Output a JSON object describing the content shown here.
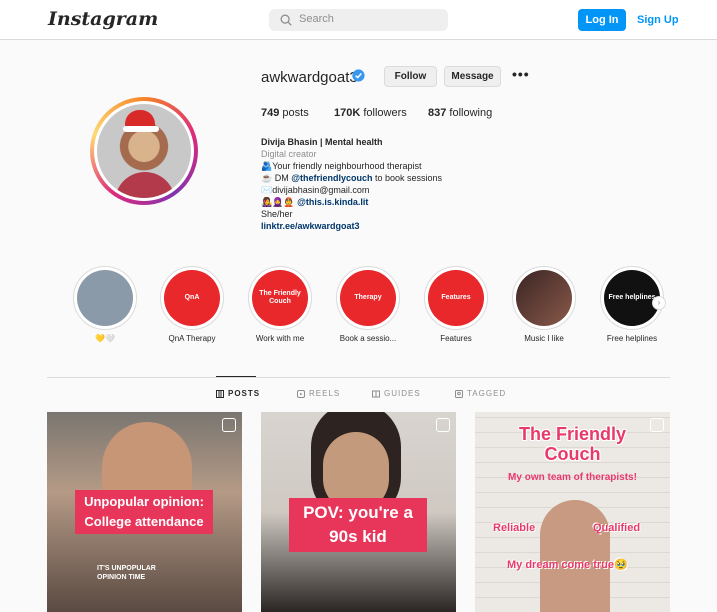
{
  "header": {
    "logo": "Instagram",
    "search_placeholder": "Search",
    "login_label": "Log In",
    "signup_label": "Sign Up"
  },
  "profile": {
    "username": "awkwardgoat3",
    "follow_label": "Follow",
    "message_label": "Message",
    "more_label": "•••",
    "stats": {
      "posts_count": "749",
      "posts_label": "posts",
      "followers_count": "170K",
      "followers_label": "followers",
      "following_count": "837",
      "following_label": "following"
    },
    "bio": {
      "name": "Divija Bhasin | Mental health",
      "category": "Digital creator",
      "line1": "🫂Your friendly neighbourhood therapist",
      "line2_prefix": "☕ DM ",
      "line2_mention": "@thefriendlycouch",
      "line2_suffix": " to book sessions",
      "line3": "✉️divijabhasin@gmail.com",
      "line4_prefix": "👩‍🎤🧕👲 ",
      "line4_mention": "@this.is.kinda.lit",
      "line5": "She/her",
      "link": "linktr.ee/awkwardgoat3"
    }
  },
  "highlights": [
    {
      "label": "💛🤍",
      "cover_text": "",
      "color": "#8a9aa8"
    },
    {
      "label": "QnA Therapy",
      "cover_text": "QnA",
      "color": "#e8282b"
    },
    {
      "label": "Work with me",
      "cover_text": "The Friendly Couch",
      "color": "#e8282b"
    },
    {
      "label": "Book a sessio...",
      "cover_text": "Therapy",
      "color": "#e8282b"
    },
    {
      "label": "Features",
      "cover_text": "Features",
      "color": "#e8282b"
    },
    {
      "label": "Music I like",
      "cover_text": "",
      "color": "#6b3a3a"
    },
    {
      "label": "Free helplines",
      "cover_text": "Free helplines",
      "color": "#111111"
    }
  ],
  "tabs": {
    "posts": "POSTS",
    "reels": "REELS",
    "guides": "GUIDES",
    "tagged": "TAGGED"
  },
  "posts": [
    {
      "caption": "Unpopular opinion: College attendance",
      "small_text": "IT'S UNPOPULAR OPINION TIME"
    },
    {
      "caption": "POV: you're a 90s kid"
    },
    {
      "title": "The Friendly Couch",
      "subtitle": "My own team of therapists!",
      "tag_left": "Reliable",
      "tag_right": "Qualified",
      "tag_bottom": "My dream come true🥹"
    }
  ],
  "colors": {
    "accent": "#0095f6",
    "highlight_red": "#e8282b",
    "caption_pink": "#e8365b"
  }
}
